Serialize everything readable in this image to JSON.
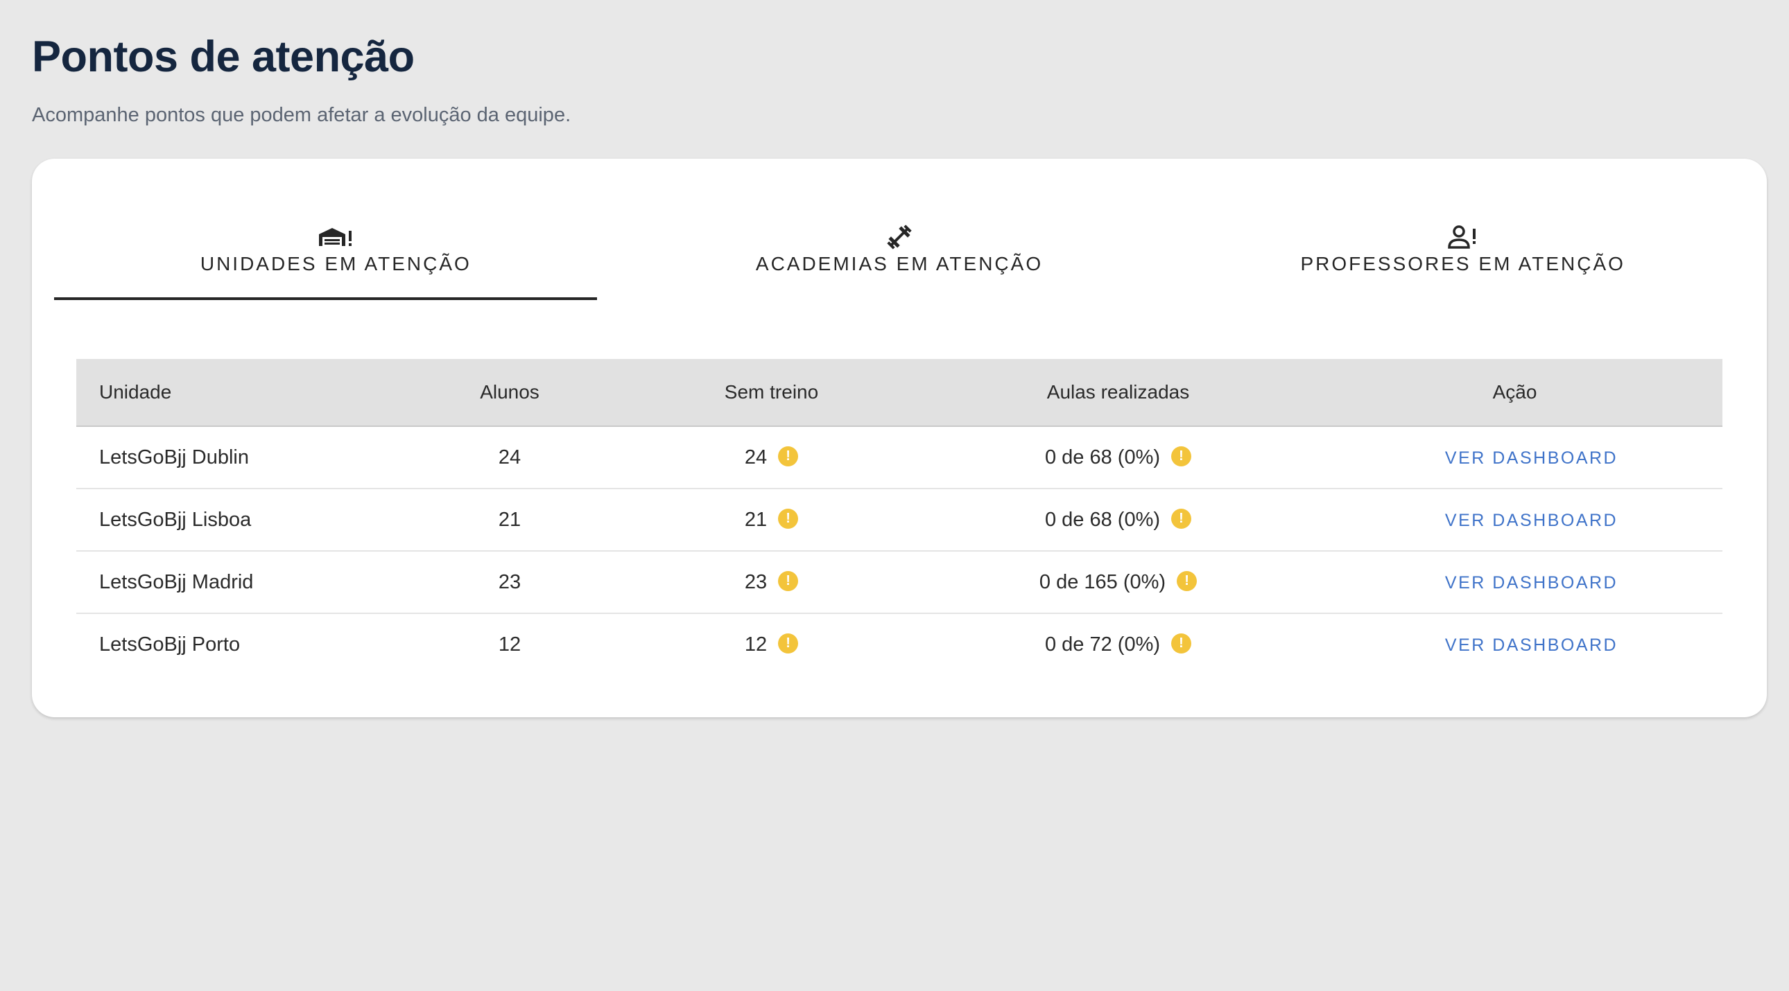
{
  "header": {
    "title": "Pontos de atenção",
    "subtitle": "Acompanhe pontos que podem afetar a evolução da equipe."
  },
  "tabs": [
    {
      "label": "UNIDADES EM ATENÇÃO",
      "icon": "warehouse-alert-icon",
      "active": true
    },
    {
      "label": "ACADEMIAS EM ATENÇÃO",
      "icon": "dumbbell-icon",
      "active": false
    },
    {
      "label": "PROFESSORES EM ATENÇÃO",
      "icon": "person-alert-icon",
      "active": false
    }
  ],
  "table": {
    "columns": [
      "Unidade",
      "Alunos",
      "Sem treino",
      "Aulas realizadas",
      "Ação"
    ],
    "rows": [
      {
        "unit": "LetsGoBjj Dublin",
        "students": "24",
        "no_training": "24",
        "classes": "0 de 68 (0%)",
        "action": "VER DASHBOARD"
      },
      {
        "unit": "LetsGoBjj Lisboa",
        "students": "21",
        "no_training": "21",
        "classes": "0 de 68 (0%)",
        "action": "VER DASHBOARD"
      },
      {
        "unit": "LetsGoBjj Madrid",
        "students": "23",
        "no_training": "23",
        "classes": "0 de 165 (0%)",
        "action": "VER DASHBOARD"
      },
      {
        "unit": "LetsGoBjj Porto",
        "students": "12",
        "no_training": "12",
        "classes": "0 de 72 (0%)",
        "action": "VER DASHBOARD"
      }
    ]
  },
  "colors": {
    "background": "#e8e8e8",
    "title": "#15263f",
    "warning": "#f3c43b",
    "link": "#3f73c9"
  },
  "warning_glyph": "!"
}
